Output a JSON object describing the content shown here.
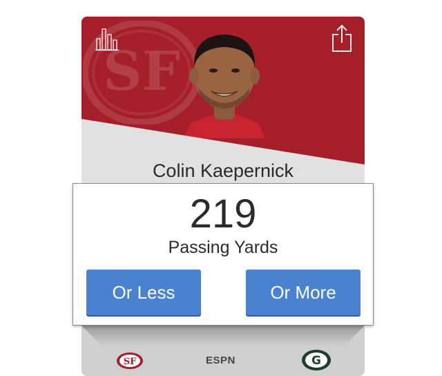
{
  "player": {
    "name": "Colin Kaepernick",
    "team_color": "#a51f2a"
  },
  "stat": {
    "value": "219",
    "label": "Passing Yards"
  },
  "actions": {
    "less_label": "Or Less",
    "more_label": "Or More",
    "accent": "#4b82cf"
  },
  "matchup": {
    "home_logo": "49ers-logo",
    "network": "ESPN",
    "away_logo": "packers-logo"
  },
  "icons": {
    "stats": "bar-chart-icon",
    "share": "share-icon"
  }
}
